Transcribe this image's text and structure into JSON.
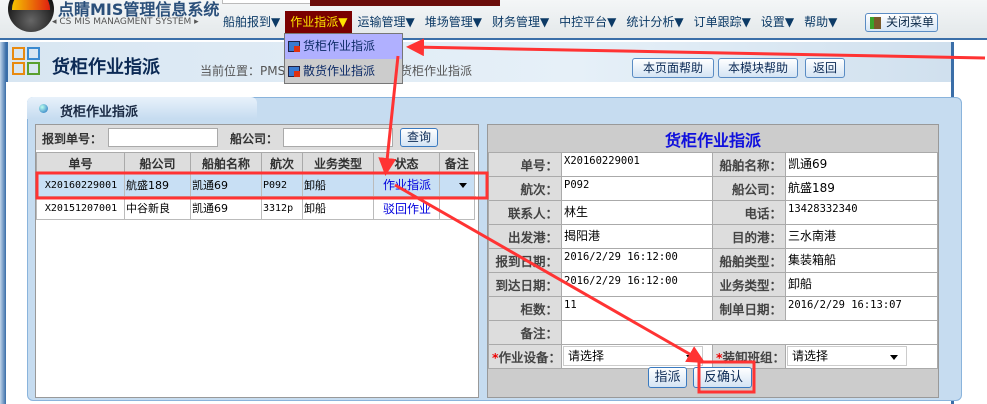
{
  "app": {
    "name": "点睛MIS管理信息系统",
    "subtitle": "CS MIS MANAGMENT SYSTEM"
  },
  "menu": [
    {
      "label": "船舶报到▼"
    },
    {
      "label": "作业指派▼"
    },
    {
      "label": "运输管理▼"
    },
    {
      "label": "堆场管理▼"
    },
    {
      "label": "财务管理▼"
    },
    {
      "label": "中控平台▼"
    },
    {
      "label": "统计分析▼"
    },
    {
      "label": "订单跟踪▼"
    },
    {
      "label": "设置▼"
    },
    {
      "label": "帮助▼"
    }
  ],
  "close_menu": "关闭菜单",
  "dropdown": [
    "货柜作业指派",
    "散货作业指派"
  ],
  "page": {
    "title": "货柜作业指派",
    "breadcrumb_a": "当前位置：PMS系",
    "breadcrumb_b": "货柜作业指派"
  },
  "help_buttons": {
    "page_help": "本页面帮助",
    "module_help": "本模块帮助",
    "back": "返回"
  },
  "panel_title": "货柜作业指派",
  "search": {
    "report_no_label": "报到单号：",
    "company_label": "船公司：",
    "report_no_value": "",
    "company_value": "",
    "query": "查询"
  },
  "grid": {
    "headers": [
      "单号",
      "船公司",
      "船舶名称",
      "航次",
      "业务类型",
      "状态",
      "备注"
    ],
    "rows": [
      [
        "X20160229001",
        "航盛189",
        "凯通69",
        "P092",
        "卸船",
        "作业指派",
        ""
      ],
      [
        "X20151207001",
        "中谷新良",
        "凯通69",
        "3312p",
        "卸船",
        "驳回作业",
        ""
      ]
    ]
  },
  "form": {
    "title": "货柜作业指派",
    "rows": [
      [
        "单号：",
        "X20160229001",
        "船舶名称：",
        "凯通69"
      ],
      [
        "航次：",
        "P092",
        "船公司：",
        "航盛189"
      ],
      [
        "联系人：",
        "林生",
        "电话：",
        "13428332340"
      ],
      [
        "出发港：",
        "揭阳港",
        "目的港：",
        "三水南港"
      ],
      [
        "报到日期：",
        "2016/2/29 16:12:00",
        "船舶类型：",
        "集装箱船"
      ],
      [
        "到达日期：",
        "2016/2/29 16:12:00",
        "业务类型：",
        "卸船"
      ],
      [
        "柜数：",
        "11",
        "制单日期：",
        "2016/2/29 16:13:07"
      ]
    ],
    "remark_label": "备注：",
    "remark_value": "",
    "equipment_label": "作业设备：",
    "equipment_value": "请选择",
    "team_label": "装卸班组：",
    "team_value": "请选择",
    "required_mark": "*",
    "assign": "指派",
    "unconfirm": "反确认"
  },
  "annotation_color": "#ff3333"
}
